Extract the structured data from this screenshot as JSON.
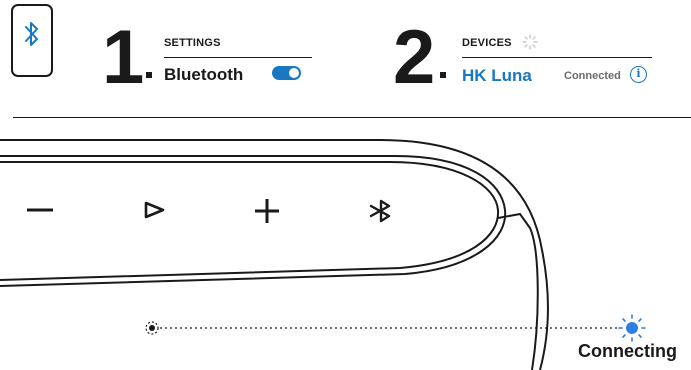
{
  "step1": {
    "number": "1",
    "label": "SETTINGS",
    "item": "Bluetooth",
    "toggle_on": true
  },
  "step2": {
    "number": "2",
    "label": "DEVICES",
    "device_name": "HK Luna",
    "status": "Connected",
    "info_glyph": "i"
  },
  "status_text": "Connecting",
  "colors": {
    "accent": "#1a78c2",
    "ink": "#1a1a1a",
    "muted": "#6b6b6b",
    "led": "#2f7fe0"
  },
  "icons": {
    "phone": "smartphone-bluetooth-icon",
    "spinner": "loading-spinner-icon",
    "info": "info-icon",
    "volume_down": "minus-icon",
    "play": "play-icon",
    "volume_up": "plus-icon",
    "bluetooth": "bluetooth-icon",
    "led_off": "led-indicator-off-icon",
    "led_on": "led-indicator-blinking-icon"
  }
}
